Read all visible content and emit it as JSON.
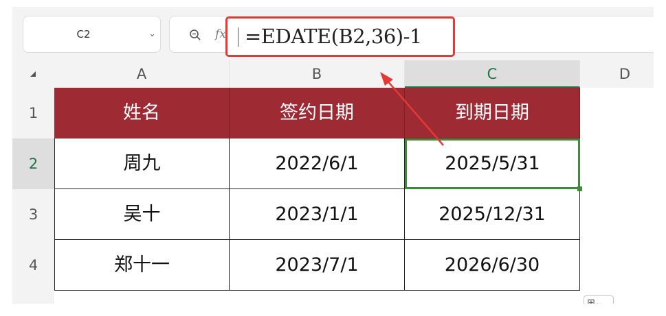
{
  "name_box": {
    "ref": "C2",
    "dropdown_icon": "chevron-down-icon"
  },
  "formula_bar": {
    "zoom_icon": "zoom-icon",
    "fx_label": "fx",
    "formula": "=EDATE(B2,36)-1"
  },
  "columns": [
    "A",
    "B",
    "C",
    "D"
  ],
  "rows": [
    "1",
    "2",
    "3",
    "4"
  ],
  "selected_cell": "C2",
  "table": {
    "headers": [
      "姓名",
      "签约日期",
      "到期日期"
    ],
    "rows": [
      [
        "周九",
        "2022/6/1",
        "2025/5/31"
      ],
      [
        "吴十",
        "2023/1/1",
        "2025/12/31"
      ],
      [
        "郑十一",
        "2023/7/1",
        "2026/6/30"
      ]
    ]
  },
  "colors": {
    "header_fill": "#9e2a33",
    "header_text": "#ffffff",
    "selection": "#3f8b3a",
    "annotation": "#e53935"
  },
  "paste_options_icon": "table-grid-icon"
}
